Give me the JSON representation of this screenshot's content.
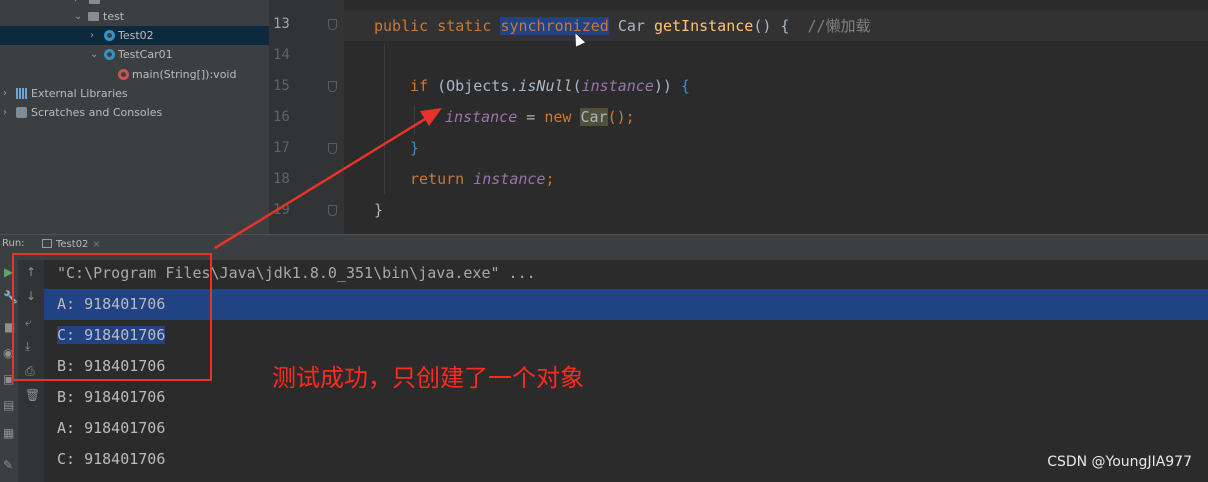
{
  "project_tree": {
    "items": [
      {
        "label": "test"
      },
      {
        "label": "Test02"
      },
      {
        "label": "TestCar01"
      },
      {
        "label": "main(String[]):void"
      },
      {
        "label": "External Libraries"
      },
      {
        "label": "Scratches and Consoles"
      }
    ]
  },
  "editor": {
    "line_numbers": [
      "13",
      "14",
      "15",
      "16",
      "17",
      "18",
      "19"
    ],
    "line13": {
      "kw1": "public static ",
      "kw_sel": "synchronized",
      "type": " Car ",
      "method": "getInstance",
      "rest": "() {  ",
      "comment": "//懒加载"
    },
    "line15": {
      "kw": "if ",
      "p1": "(",
      "cls": "Objects.",
      "static": "isNull",
      "p2": "(",
      "field": "instance",
      "p3": "))",
      "brace": " {"
    },
    "line16": {
      "field": "instance",
      "eq": " = ",
      "kw": "new ",
      "car": "Car",
      "end": "();"
    },
    "line17": {
      "brace": "}"
    },
    "line18": {
      "kw": "return ",
      "field": "instance",
      "end": ";"
    },
    "line19": {
      "brace": "}"
    }
  },
  "run_window": {
    "label": "Run:",
    "tab_label": "Test02",
    "tab_close": "×",
    "console_lines": [
      "\"C:\\Program Files\\Java\\jdk1.8.0_351\\bin\\java.exe\" ...",
      "A: 918401706",
      "C: 918401706",
      "B: 918401706",
      "B: 918401706",
      "A: 918401706",
      "C: 918401706"
    ]
  },
  "annotation": {
    "text": "测试成功，只创建了一个对象",
    "color": "#ff2a1e"
  },
  "watermark": "CSDN @YoungJIA977"
}
